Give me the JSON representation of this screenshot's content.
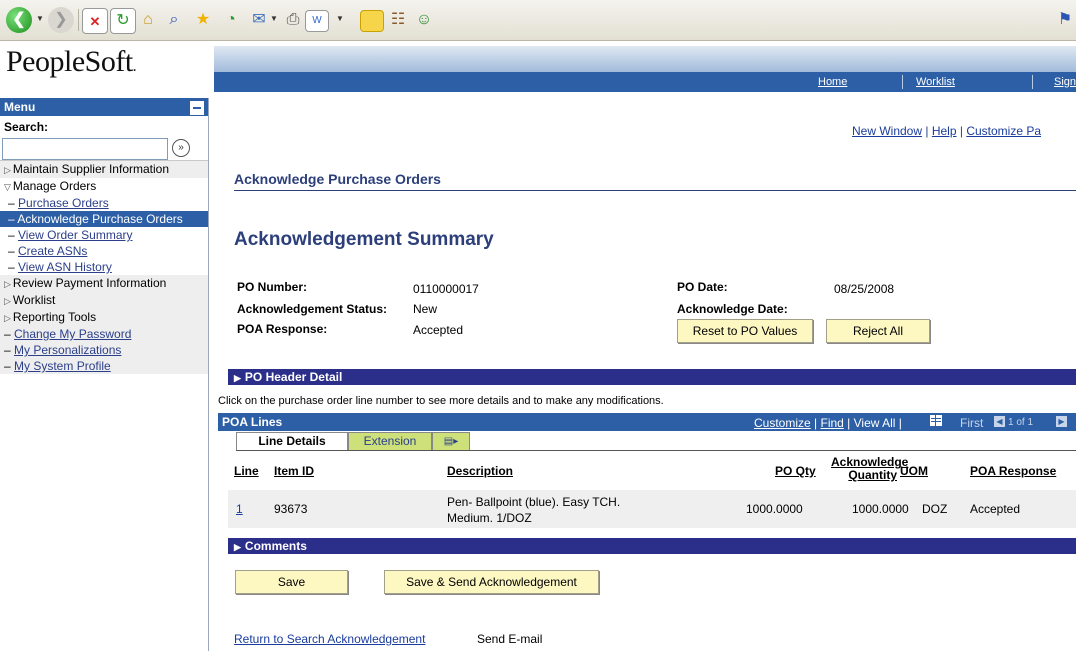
{
  "browser": {
    "icons": [
      "back-icon",
      "forward-icon",
      "stop-icon",
      "refresh-icon",
      "home-icon",
      "search-icon",
      "favorites-icon",
      "history-icon",
      "mail-icon",
      "print-icon",
      "edit-icon",
      "notes-icon",
      "research-icon",
      "messenger-icon"
    ]
  },
  "header": {
    "logo": "PeopleSoft",
    "nav": [
      "Home",
      "Worklist",
      "Sign"
    ]
  },
  "menu": {
    "title": "Menu",
    "search_label": "Search:",
    "search_value": "",
    "items": [
      {
        "label": "Maintain Supplier Information",
        "type": "folder"
      },
      {
        "label": "Manage Orders",
        "type": "folder-open"
      },
      {
        "label": "Purchase Orders",
        "type": "sub"
      },
      {
        "label": "Acknowledge Purchase Orders",
        "type": "active"
      },
      {
        "label": "View Order Summary",
        "type": "sub"
      },
      {
        "label": "Create ASNs",
        "type": "sub"
      },
      {
        "label": "View ASN History",
        "type": "sub"
      },
      {
        "label": "Review Payment Information",
        "type": "folder"
      },
      {
        "label": "Worklist",
        "type": "folder"
      },
      {
        "label": "Reporting Tools",
        "type": "folder"
      },
      {
        "label": "Change My Password",
        "type": "link"
      },
      {
        "label": "My Personalizations",
        "type": "link"
      },
      {
        "label": "My System Profile",
        "type": "link"
      }
    ]
  },
  "toplinks": {
    "new_window": "New Window",
    "help": "Help",
    "customize": "Customize Pa"
  },
  "page": {
    "title": "Acknowledge Purchase Orders",
    "subtitle": "Acknowledgement Summary"
  },
  "fields": {
    "po_number_label": "PO Number:",
    "po_number": "0110000017",
    "ack_status_label": "Acknowledgement Status:",
    "ack_status": "New",
    "poa_response_label": "POA Response:",
    "poa_response": "Accepted",
    "po_date_label": "PO Date:",
    "po_date": "08/25/2008",
    "ack_date_label": "Acknowledge Date:"
  },
  "buttons": {
    "reset": "Reset to PO Values",
    "reject": "Reject All",
    "save": "Save",
    "save_send": "Save & Send Acknowledgement"
  },
  "sections": {
    "po_header": "PO Header Detail",
    "comments": "Comments"
  },
  "note": "Click on the purchase order line number to see more details and to make any modifications.",
  "poa_lines": {
    "title": "POA Lines",
    "customize": "Customize",
    "find": "Find",
    "view_all": "View All",
    "first": "First",
    "range": "1 of 1",
    "tabs": [
      "Line Details",
      "Extension"
    ],
    "headers": {
      "line": "Line",
      "item_id": "Item ID",
      "description": "Description",
      "po_qty": "PO Qty",
      "ack_qty_1": "Acknowledge",
      "ack_qty_2": "Quantity",
      "uom": "UOM",
      "poa_response": "POA Response"
    },
    "rows": [
      {
        "line": "1",
        "item_id": "93673",
        "desc_1": "Pen- Ballpoint (blue). Easy TCH.",
        "desc_2": "Medium. 1/DOZ",
        "po_qty": "1000.0000",
        "ack_qty": "1000.0000",
        "uom": "DOZ",
        "poa_response": "Accepted"
      }
    ]
  },
  "footer": {
    "return_link": "Return to Search Acknowledgement",
    "send_email": "Send E-mail"
  },
  "colors": {
    "nav_blue": "#2c5fa6",
    "section_bar": "#2c2f8a",
    "button_bg": "#fdf7c2",
    "title": "#2c3f7a"
  }
}
